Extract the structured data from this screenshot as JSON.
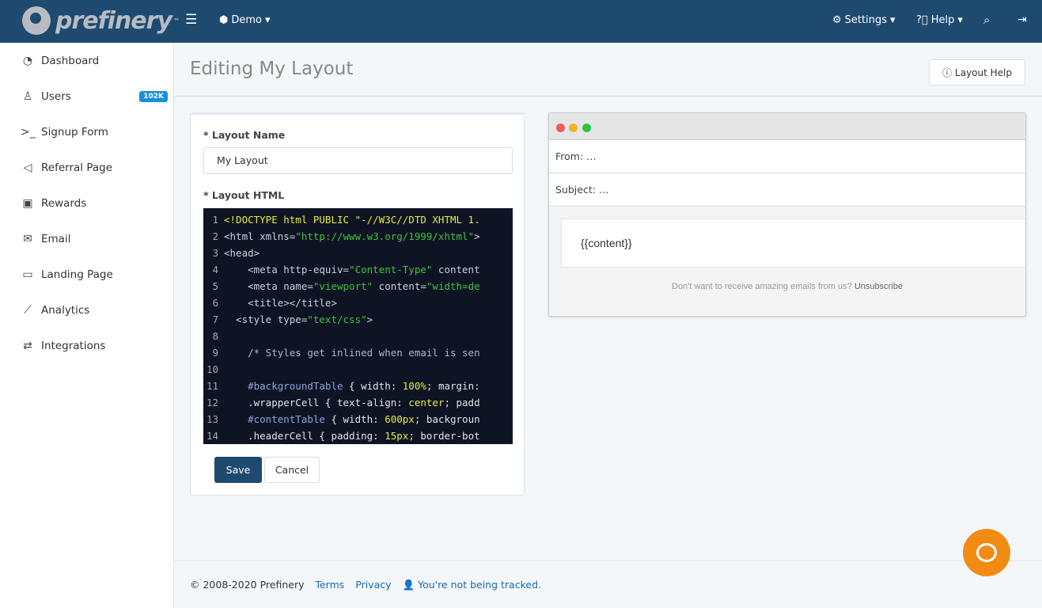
{
  "brand": {
    "name": "prefinery",
    "tm": "™"
  },
  "topnav": {
    "menu_icon": "hamburger-icon",
    "project": "Demo",
    "settings": "Settings",
    "help": "Help"
  },
  "sidebar": {
    "items": [
      {
        "label": "Dashboard",
        "icon": "gauge-icon",
        "glyph": "◔"
      },
      {
        "label": "Users",
        "icon": "user-icon",
        "glyph": "♙",
        "badge": "102K"
      },
      {
        "label": "Signup Form",
        "icon": "terminal-icon",
        "glyph": ">_"
      },
      {
        "label": "Referral Page",
        "icon": "megaphone-icon",
        "glyph": "◁"
      },
      {
        "label": "Rewards",
        "icon": "ticket-icon",
        "glyph": "▣"
      },
      {
        "label": "Email",
        "icon": "envelope-icon",
        "glyph": "✉"
      },
      {
        "label": "Landing Page",
        "icon": "monitor-icon",
        "glyph": "▭"
      },
      {
        "label": "Analytics",
        "icon": "chart-icon",
        "glyph": "⟋"
      },
      {
        "label": "Integrations",
        "icon": "exchange-icon",
        "glyph": "⇄"
      }
    ]
  },
  "page": {
    "title": "Editing My Layout",
    "help_button": "Layout Help"
  },
  "form": {
    "name_label": "* Layout Name",
    "name_value": "My Layout",
    "html_label": "* Layout HTML",
    "save": "Save",
    "cancel": "Cancel",
    "code_lines": [
      [
        [
          "<!DOCTYPE html PUBLIC \"-//W3C//DTD XHTML 1.",
          "kw"
        ]
      ],
      [
        [
          "<html xmlns=",
          "tag"
        ],
        [
          "\"http://www.w3.org/1999/xhtml\"",
          "str"
        ],
        [
          ">",
          "tag"
        ]
      ],
      [
        [
          "<head>",
          "tag"
        ]
      ],
      [
        [
          "    <meta http-equiv=",
          "tag"
        ],
        [
          "\"Content-Type\"",
          "str"
        ],
        [
          " content",
          "tag"
        ]
      ],
      [
        [
          "    <meta name=",
          "tag"
        ],
        [
          "\"viewport\"",
          "str"
        ],
        [
          " content=",
          "tag"
        ],
        [
          "\"width=de",
          "str"
        ]
      ],
      [
        [
          "    <title></title>",
          "tag"
        ]
      ],
      [
        [
          "  <style type=",
          "tag"
        ],
        [
          "\"text/css\"",
          "str"
        ],
        [
          ">",
          "tag"
        ]
      ],
      [],
      [
        [
          "    /* Styles get inlined when email is sen",
          "com"
        ]
      ],
      [],
      [
        [
          "    #backgroundTable",
          "sel"
        ],
        [
          " { width: ",
          "txt"
        ],
        [
          "100%",
          "num"
        ],
        [
          "; margin:",
          "txt"
        ]
      ],
      [
        [
          "    .wrapperCell { text-align: ",
          "txt"
        ],
        [
          "center",
          "num"
        ],
        [
          "; padd",
          "txt"
        ]
      ],
      [
        [
          "    #contentTable",
          "sel"
        ],
        [
          " { width: ",
          "txt"
        ],
        [
          "600px",
          "num"
        ],
        [
          "; backgroun",
          "txt"
        ]
      ],
      [
        [
          "    .headerCell { padding: ",
          "txt"
        ],
        [
          "15px",
          "num"
        ],
        [
          "; border-bot",
          "txt"
        ]
      ]
    ]
  },
  "preview": {
    "from": "From: …",
    "subject": "Subject: …",
    "content": "{{content}}",
    "footer_text": "Don't want to receive amazing emails from us? ",
    "unsubscribe": "Unsubscribe",
    "dots": [
      "#ee5f57",
      "#f2b32b",
      "#27c840"
    ]
  },
  "footer": {
    "copyright": "© 2008-2020 Prefinery",
    "terms": "Terms",
    "privacy": "Privacy",
    "tracking": "You're not being tracked."
  },
  "colors": {
    "header": "#1e4a70",
    "accent": "#1869b0",
    "chat": "#f28b14"
  }
}
